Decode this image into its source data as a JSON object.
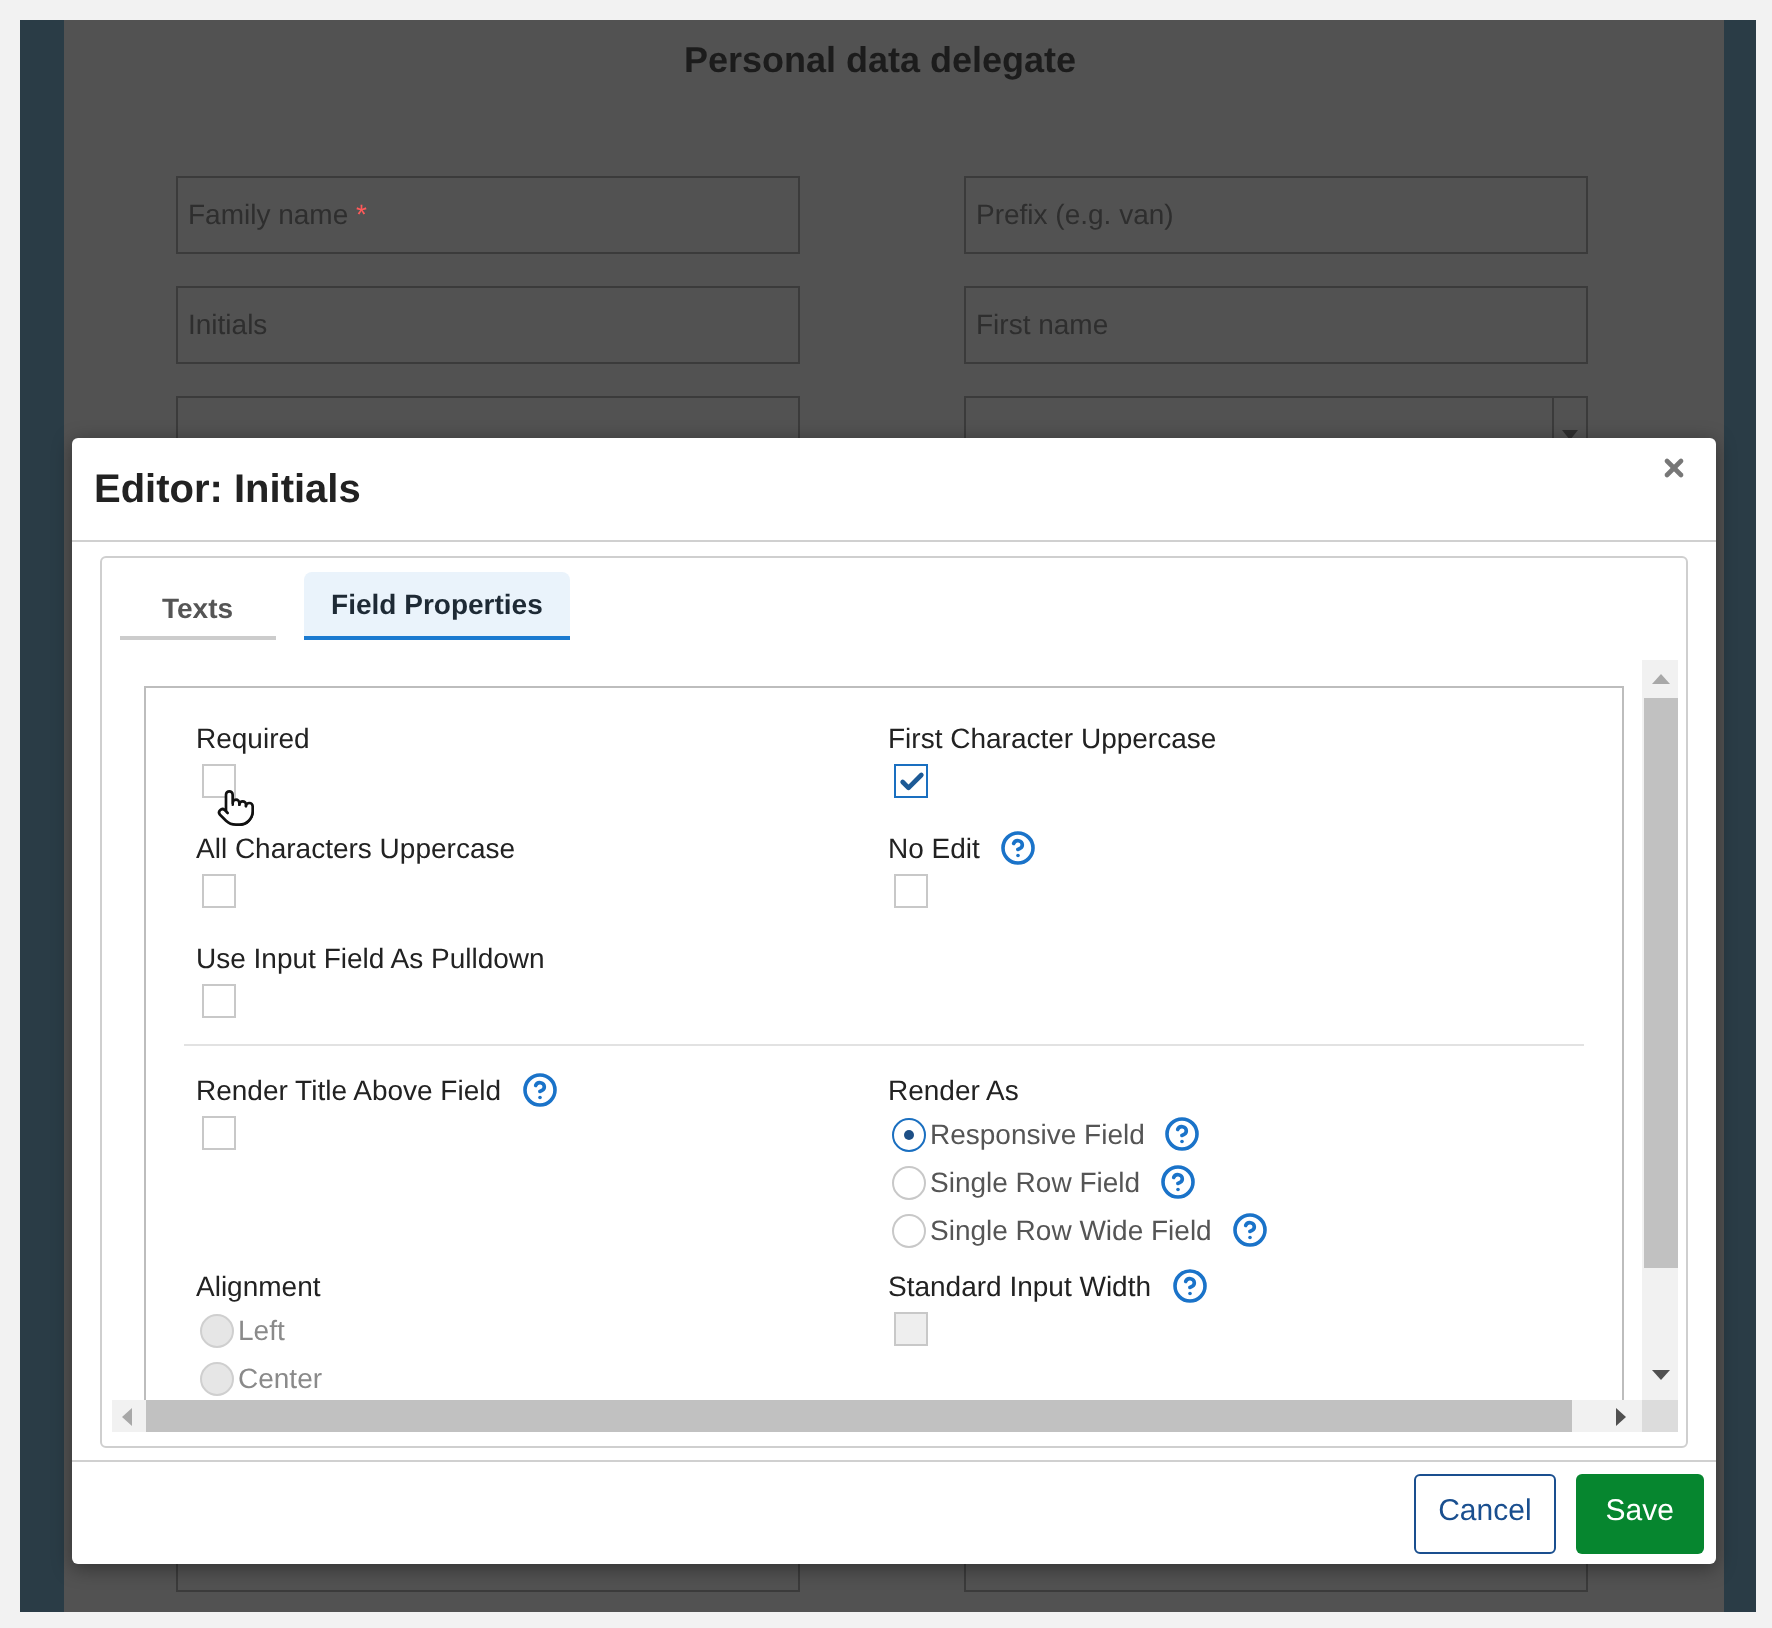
{
  "page": {
    "title": "Personal data delegate",
    "fields": [
      {
        "kind": "input",
        "placeholder": "Family name",
        "required_mark": "*"
      },
      {
        "kind": "input",
        "placeholder": "Prefix (e.g. van)"
      },
      {
        "kind": "input",
        "placeholder": "Initials"
      },
      {
        "kind": "input",
        "placeholder": "First name"
      },
      {
        "kind": "input"
      },
      {
        "kind": "select"
      }
    ],
    "bottom_fields": [
      {
        "kind": "input"
      },
      {
        "kind": "input"
      }
    ]
  },
  "dialog": {
    "title": "Editor: Initials",
    "tabs": [
      {
        "label": "Texts",
        "selected": false
      },
      {
        "label": "Field Properties",
        "selected": true
      }
    ],
    "sections": [
      {
        "rows": [
          [
            {
              "kind": "checkbox",
              "label": "Required",
              "help": false,
              "checked": false,
              "disabled": false
            },
            {
              "kind": "checkbox",
              "label": "First Character Uppercase",
              "help": false,
              "checked": true,
              "disabled": false
            }
          ],
          [
            {
              "kind": "checkbox",
              "label": "All Characters Uppercase",
              "help": false,
              "checked": false,
              "disabled": false
            },
            {
              "kind": "checkbox",
              "label": "No Edit",
              "help": true,
              "checked": false,
              "disabled": false
            }
          ],
          [
            {
              "kind": "checkbox",
              "label": "Use Input Field As Pulldown",
              "help": false,
              "checked": false,
              "disabled": false
            }
          ]
        ]
      },
      {
        "rows": [
          [
            {
              "kind": "checkbox",
              "label": "Render Title Above Field",
              "help": true,
              "checked": false,
              "disabled": false
            },
            {
              "kind": "radios",
              "label": "Render As",
              "options": [
                {
                  "label": "Responsive Field",
                  "selected": true,
                  "help": true,
                  "disabled": false
                },
                {
                  "label": "Single Row Field",
                  "selected": false,
                  "help": true,
                  "disabled": false
                },
                {
                  "label": "Single Row Wide Field",
                  "selected": false,
                  "help": true,
                  "disabled": false
                }
              ]
            }
          ],
          [
            {
              "kind": "radios",
              "label": "Alignment",
              "options": [
                {
                  "label": "Left",
                  "selected": false,
                  "help": false,
                  "disabled": true
                },
                {
                  "label": "Center",
                  "selected": false,
                  "help": false,
                  "disabled": true
                }
              ]
            },
            {
              "kind": "checkbox",
              "label": "Standard Input Width",
              "help": true,
              "checked": false,
              "disabled": true
            }
          ]
        ]
      }
    ],
    "buttons": [
      {
        "label": "Cancel",
        "kind": "secondary"
      },
      {
        "label": "Save",
        "kind": "primary"
      }
    ]
  }
}
